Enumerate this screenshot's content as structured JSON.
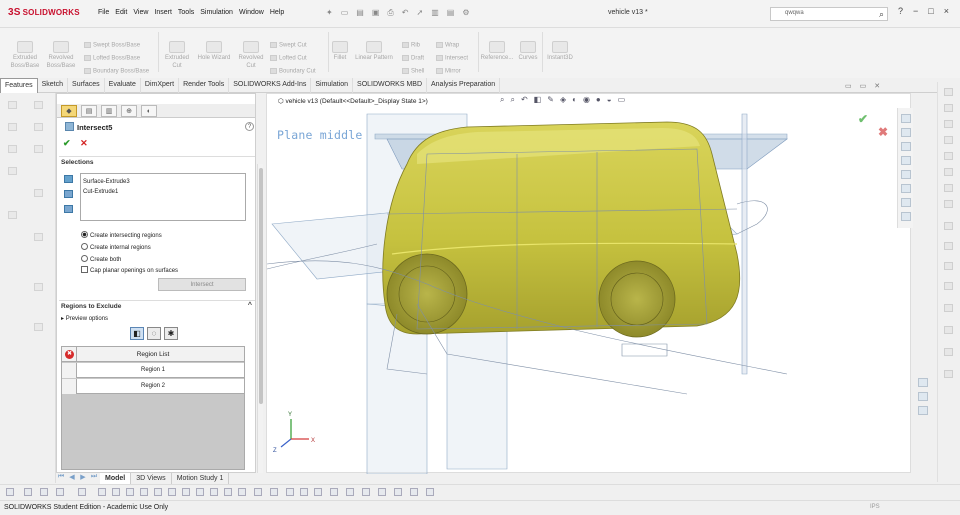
{
  "app": {
    "logo_text": "SOLIDWORKS",
    "menu": [
      "File",
      "Edit",
      "View",
      "Insert",
      "Tools",
      "Simulation",
      "Window",
      "Help"
    ],
    "document_title": "vehicle v13 *",
    "search_value": "qwqwa",
    "window_controls": [
      "?",
      "−",
      "□",
      "×"
    ]
  },
  "ribbon": {
    "big_buttons": [
      "Extruded Boss/Base",
      "Revolved Boss/Base",
      "Extruded Cut",
      "Hole Wizard",
      "Revolved Cut",
      "Fillet",
      "Linear Pattern",
      "Reference...",
      "Curves",
      "Instant3D"
    ],
    "small_buttons": [
      "Swept Boss/Base",
      "Lofted Boss/Base",
      "Boundary Boss/Base",
      "Swept Cut",
      "Lofted Cut",
      "Boundary Cut",
      "Rib",
      "Draft",
      "Shell",
      "Wrap",
      "Intersect",
      "Mirror"
    ]
  },
  "command_tabs": [
    {
      "label": "Features",
      "active": true
    },
    {
      "label": "Sketch",
      "active": false
    },
    {
      "label": "Surfaces",
      "active": false
    },
    {
      "label": "Evaluate",
      "active": false
    },
    {
      "label": "DimXpert",
      "active": false
    },
    {
      "label": "Render Tools",
      "active": false
    },
    {
      "label": "SOLIDWORKS Add-Ins",
      "active": false
    },
    {
      "label": "Simulation",
      "active": false
    },
    {
      "label": "SOLIDWORKS MBD",
      "active": false
    },
    {
      "label": "Analysis Preparation",
      "active": false
    }
  ],
  "property_manager": {
    "title": "Intersect5",
    "selections_header": "Selections",
    "selections": [
      "Surface-Extrude3",
      "Cut-Extrude1"
    ],
    "options": [
      {
        "label": "Create intersecting regions",
        "type": "radio",
        "checked": true
      },
      {
        "label": "Create internal regions",
        "type": "radio",
        "checked": false
      },
      {
        "label": "Create both",
        "type": "radio",
        "checked": false
      },
      {
        "label": "Cap planar openings on surfaces",
        "type": "checkbox",
        "checked": false
      }
    ],
    "intersect_button": "Intersect",
    "regions_header": "Regions to Exclude",
    "preview_label": "Preview options",
    "table_header": "Region List",
    "regions": [
      "Region   1",
      "Region   2"
    ]
  },
  "bottom_tabs": [
    "Model",
    "3D Views",
    "Motion Study 1"
  ],
  "viewport": {
    "breadcrumb": "vehicle v13  (Default<<Default>_Display State 1>)",
    "plane_label": "Plane middle",
    "axis_labels": {
      "x": "X",
      "y": "Y",
      "z": "Z"
    }
  },
  "status": {
    "text": "SOLIDWORKS Student Edition - Academic Use Only",
    "units": "IPS"
  },
  "colors": {
    "body_fill": "#c9c545",
    "plane_fill": "#b8c9dc",
    "accent_red": "#c8102e",
    "ok_green": "#2b9b2b"
  }
}
